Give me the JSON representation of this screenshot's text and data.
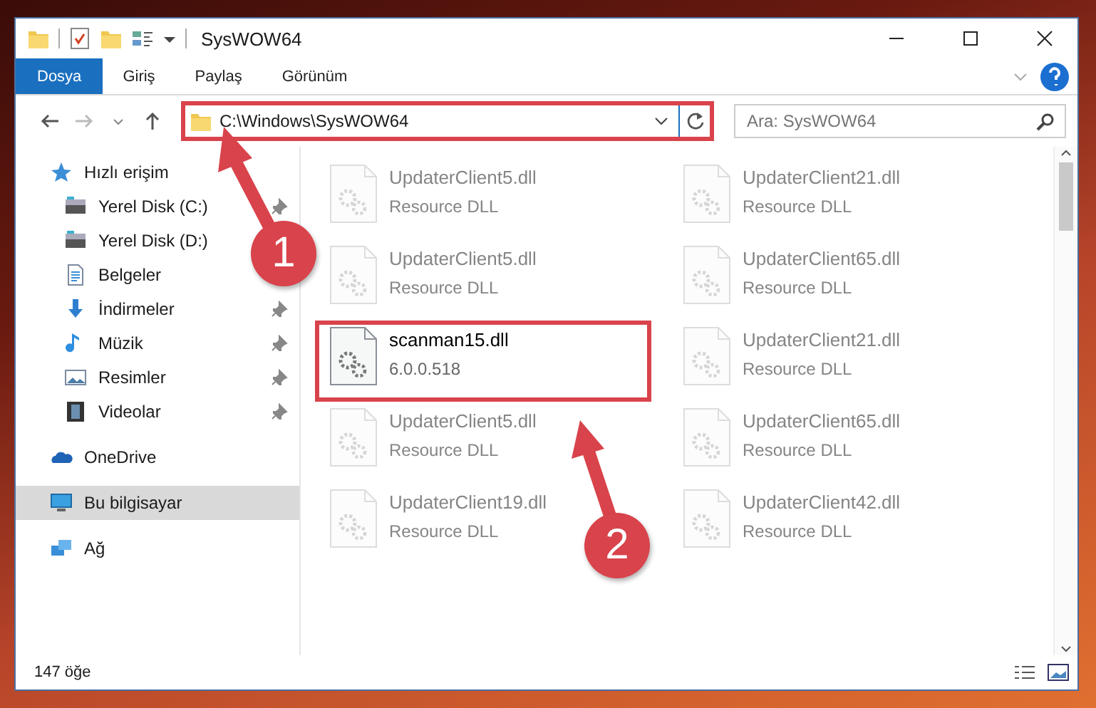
{
  "window": {
    "title": "SysWOW64"
  },
  "ribbon_tabs": [
    {
      "label": "Dosya",
      "selected": true
    },
    {
      "label": "Giriş",
      "selected": false
    },
    {
      "label": "Paylaş",
      "selected": false
    },
    {
      "label": "Görünüm",
      "selected": false
    }
  ],
  "address_bar": {
    "value": "C:\\Windows\\SysWOW64"
  },
  "search": {
    "placeholder": "Ara: SysWOW64"
  },
  "sidebar": {
    "items": [
      {
        "label": "Hızlı erişim",
        "kind": "star",
        "group": true,
        "selected": false,
        "pinned": false
      },
      {
        "label": "Yerel Disk (C:)",
        "kind": "drive",
        "group": false,
        "selected": false,
        "pinned": true
      },
      {
        "label": "Yerel Disk (D:)",
        "kind": "drive",
        "group": false,
        "selected": false,
        "pinned": false
      },
      {
        "label": "Belgeler",
        "kind": "document",
        "group": false,
        "selected": false,
        "pinned": false
      },
      {
        "label": "İndirmeler",
        "kind": "download",
        "group": false,
        "selected": false,
        "pinned": true
      },
      {
        "label": "Müzik",
        "kind": "music",
        "group": false,
        "selected": false,
        "pinned": true
      },
      {
        "label": "Resimler",
        "kind": "picture",
        "group": false,
        "selected": false,
        "pinned": true
      },
      {
        "label": "Videolar",
        "kind": "video",
        "group": false,
        "selected": false,
        "pinned": true
      },
      {
        "label": "OneDrive",
        "kind": "cloud",
        "group": true,
        "selected": false,
        "pinned": false
      },
      {
        "label": "Bu bilgisayar",
        "kind": "computer",
        "group": true,
        "selected": true,
        "pinned": false
      },
      {
        "label": "Ağ",
        "kind": "network",
        "group": true,
        "selected": false,
        "pinned": false
      }
    ]
  },
  "files": [
    {
      "name": "UpdaterClient5.dll",
      "detail": "Resource DLL",
      "faded": true,
      "framed": false
    },
    {
      "name": "UpdaterClient21.dll",
      "detail": "Resource DLL",
      "faded": true,
      "framed": false
    },
    {
      "name": "UpdaterClient5.dll",
      "detail": "Resource DLL",
      "faded": true,
      "framed": false
    },
    {
      "name": "UpdaterClient65.dll",
      "detail": "Resource DLL",
      "faded": true,
      "framed": false
    },
    {
      "name": "scanman15.dll",
      "detail": "6.0.0.518",
      "faded": false,
      "framed": true
    },
    {
      "name": "UpdaterClient21.dll",
      "detail": "Resource DLL",
      "faded": true,
      "framed": false
    },
    {
      "name": "UpdaterClient5.dll",
      "detail": "Resource DLL",
      "faded": true,
      "framed": false
    },
    {
      "name": "UpdaterClient65.dll",
      "detail": "Resource DLL",
      "faded": true,
      "framed": false
    },
    {
      "name": "UpdaterClient19.dll",
      "detail": "Resource DLL",
      "faded": true,
      "framed": false
    },
    {
      "name": "UpdaterClient42.dll",
      "detail": "Resource DLL",
      "faded": true,
      "framed": false
    }
  ],
  "status_bar": {
    "item_count": "147 öğe"
  },
  "annotations": [
    {
      "number": "1"
    },
    {
      "number": "2"
    }
  ]
}
